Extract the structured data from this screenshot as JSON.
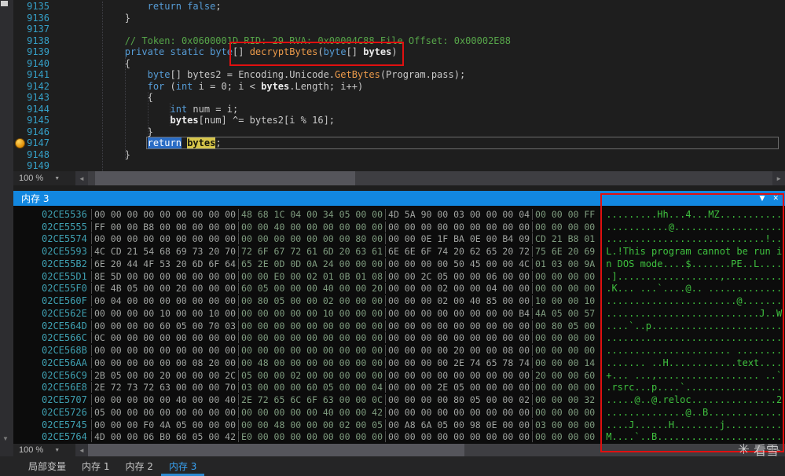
{
  "colors": {
    "accent_blue": "#1287e0",
    "annotation_red": "#e01010",
    "ascii_green": "#3fc13f",
    "address_teal": "#3e9fb0",
    "keyword_blue": "#569cd6",
    "comment_green": "#57a64a",
    "method_orange": "#ec9a4a",
    "selection_blue": "#2a6cc4",
    "highlight_yellow": "#d6c54a",
    "breakpoint_orange": "#e08900"
  },
  "icons": {
    "chevron_down": "▼",
    "close": "✕",
    "left_arrow": "◄",
    "right_arrow": "►"
  },
  "editor": {
    "zoom": "100 %",
    "current_line": "9147",
    "lines": [
      {
        "num": "9135",
        "tokens": [
          [
            "p",
            "                "
          ],
          [
            "k",
            "return"
          ],
          [
            "p",
            " "
          ],
          [
            "k",
            "false"
          ],
          [
            "p",
            ";"
          ]
        ]
      },
      {
        "num": "9136",
        "tokens": [
          [
            "p",
            "            }"
          ]
        ]
      },
      {
        "num": "9137",
        "tokens": []
      },
      {
        "num": "9138",
        "tokens": [
          [
            "p",
            "            "
          ],
          [
            "c",
            "// Token: 0x0600001D RID: 29 RVA: 0x00004C88 File Offset: 0x00002E88"
          ]
        ]
      },
      {
        "num": "9139",
        "tokens": [
          [
            "p",
            "            "
          ],
          [
            "k",
            "private"
          ],
          [
            "p",
            " "
          ],
          [
            "k",
            "static"
          ],
          [
            "p",
            " "
          ],
          [
            "k",
            "byte"
          ],
          [
            "p",
            "[] "
          ],
          [
            "m",
            "decryptBytes"
          ],
          [
            "p",
            "("
          ],
          [
            "k",
            "byte"
          ],
          [
            "p",
            "[] "
          ],
          [
            "b",
            "bytes"
          ],
          [
            "p",
            ")"
          ]
        ]
      },
      {
        "num": "9140",
        "tokens": [
          [
            "p",
            "            {"
          ]
        ]
      },
      {
        "num": "9141",
        "tokens": [
          [
            "p",
            "                "
          ],
          [
            "k",
            "byte"
          ],
          [
            "p",
            "[] bytes2 = Encoding.Unicode."
          ],
          [
            "m",
            "GetBytes"
          ],
          [
            "p",
            "(Program.pass);"
          ]
        ]
      },
      {
        "num": "9142",
        "tokens": [
          [
            "p",
            "                "
          ],
          [
            "k",
            "for"
          ],
          [
            "p",
            " ("
          ],
          [
            "k",
            "int"
          ],
          [
            "p",
            " i = 0; i < "
          ],
          [
            "b",
            "bytes"
          ],
          [
            "p",
            ".Length; i++)"
          ]
        ]
      },
      {
        "num": "9143",
        "tokens": [
          [
            "p",
            "                {"
          ]
        ]
      },
      {
        "num": "9144",
        "tokens": [
          [
            "p",
            "                    "
          ],
          [
            "k",
            "int"
          ],
          [
            "p",
            " num = i;"
          ]
        ]
      },
      {
        "num": "9145",
        "tokens": [
          [
            "p",
            "                    "
          ],
          [
            "b",
            "bytes"
          ],
          [
            "p",
            "[num] ^= bytes2[i % 16];"
          ]
        ]
      },
      {
        "num": "9146",
        "tokens": [
          [
            "p",
            "                }"
          ]
        ]
      },
      {
        "num": "9147",
        "current": true,
        "tokens": [
          [
            "p",
            "                "
          ],
          [
            "sel",
            "return"
          ],
          [
            "p",
            " "
          ],
          [
            "hl",
            "bytes"
          ],
          [
            "p",
            ";"
          ]
        ]
      },
      {
        "num": "9148",
        "tokens": [
          [
            "p",
            "            }"
          ]
        ]
      },
      {
        "num": "9149",
        "tokens": []
      }
    ]
  },
  "memory": {
    "title": "内存 3",
    "zoom": "100 %",
    "group_sizes": [
      9,
      9,
      9,
      4
    ],
    "rows": [
      {
        "addr": "02CE5536",
        "hex": "00 00 00 00 00 00 00 00 00 48 68 1C 04 00 34 05 00 00 4D 5A 90 00 03 00 00 00 04 00 00 00 FF",
        "ascii": ".........Hh...4...MZ..........."
      },
      {
        "addr": "02CE5555",
        "hex": "FF 00 00 B8 00 00 00 00 00 00 00 40 00 00 00 00 00 00 00 00 00 00 00 00 00 00 00 00 00 00 00",
        "ascii": "...........@..................."
      },
      {
        "addr": "02CE5574",
        "hex": "00 00 00 00 00 00 00 00 00 00 00 00 00 00 00 00 80 00 00 00 0E 1F BA 0E 00 B4 09 CD 21 B8 01",
        "ascii": "............................!.."
      },
      {
        "addr": "02CE5593",
        "hex": "4C CD 21 54 68 69 73 20 70 72 6F 67 72 61 6D 20 63 61 6E 6E 6F 74 20 62 65 20 72 75 6E 20 69",
        "ascii": "L.!This program cannot be run i"
      },
      {
        "addr": "02CE55B2",
        "hex": "6E 20 44 4F 53 20 6D 6F 64 65 2E 0D 0D 0A 24 00 00 00 00 00 00 00 50 45 00 00 4C 01 03 00 9A",
        "ascii": "n DOS mode....$.......PE..L...."
      },
      {
        "addr": "02CE55D1",
        "hex": "8E 5D 00 00 00 00 00 00 00 00 00 E0 00 02 01 0B 01 08 00 00 2C 05 00 00 06 00 00 00 00 00 00",
        "ascii": ".]..................,.........."
      },
      {
        "addr": "02CE55F0",
        "hex": "0E 4B 05 00 00 20 00 00 00 60 05 00 00 00 40 00 00 20 00 00 00 02 00 00 04 00 00 00 00 00 00",
        "ascii": ".K... ...`....@.. ............."
      },
      {
        "addr": "02CE560F",
        "hex": "00 04 00 00 00 00 00 00 00 00 80 05 00 00 02 00 00 00 00 00 00 02 00 40 85 00 00 10 00 00 10",
        "ascii": ".......................@......."
      },
      {
        "addr": "02CE562E",
        "hex": "00 00 00 00 10 00 00 10 00 00 00 00 00 00 10 00 00 00 00 00 00 00 00 00 00 00 B4 4A 05 00 57",
        "ascii": "...........................J..W"
      },
      {
        "addr": "02CE564D",
        "hex": "00 00 00 00 60 05 00 70 03 00 00 00 00 00 00 00 00 00 00 00 00 00 00 00 00 00 00 00 80 05 00",
        "ascii": "....`..p......................."
      },
      {
        "addr": "02CE566C",
        "hex": "0C 00 00 00 00 00 00 00 00 00 00 00 00 00 00 00 00 00 00 00 00 00 00 00 00 00 00 00 00 00 00",
        "ascii": "..............................."
      },
      {
        "addr": "02CE568B",
        "hex": "00 00 00 00 00 00 00 00 00 00 00 00 00 00 00 00 00 00 00 00 00 00 20 00 00 08 00 00 00 00 00",
        "ascii": "...................... ........"
      },
      {
        "addr": "02CE56AA",
        "hex": "00 00 00 00 00 00 08 20 00 00 48 00 00 00 00 00 00 00 00 00 00 00 2E 74 65 78 74 00 00 00 14",
        "ascii": "....... ..H............text...."
      },
      {
        "addr": "02CE56C9",
        "hex": "2B 05 00 00 20 00 00 00 2C 05 00 00 02 00 00 00 00 00 00 00 00 00 00 00 00 00 00 20 00 00 60",
        "ascii": "+... ...,.................. ..`"
      },
      {
        "addr": "02CE56E8",
        "hex": "2E 72 73 72 63 00 00 00 70 03 00 00 00 60 05 00 00 04 00 00 00 2E 05 00 00 00 00 00 00 00 00",
        "ascii": ".rsrc...p....`................."
      },
      {
        "addr": "02CE5707",
        "hex": "00 00 00 00 00 40 00 00 40 2E 72 65 6C 6F 63 00 00 0C 00 00 00 00 80 05 00 00 02 00 00 00 32",
        "ascii": ".....@..@.reloc...............2"
      },
      {
        "addr": "02CE5726",
        "hex": "05 00 00 00 00 00 00 00 00 00 00 00 00 00 40 00 00 42 00 00 00 00 00 00 00 00 00 00 00 00 00",
        "ascii": "..............@..B............."
      },
      {
        "addr": "02CE5745",
        "hex": "00 00 00 F0 4A 05 00 00 00 00 00 48 00 00 00 02 00 05 00 A8 6A 05 00 98 0E 00 00 03 00 00 00",
        "ascii": "....J......H........j.........."
      },
      {
        "addr": "02CE5764",
        "hex": "4D 00 00 06 B0 60 05 00 42 E0 00 00 00 00 00 00 00 00 00 00 00 00 00 00 00 00 00 00 00 00 00",
        "ascii": "M....`..B......................"
      }
    ]
  },
  "bottom_tabs": [
    {
      "id": "locals",
      "label": "局部变量",
      "active": false
    },
    {
      "id": "memory-1",
      "label": "内存 1",
      "active": false
    },
    {
      "id": "memory-2",
      "label": "内存 2",
      "active": false
    },
    {
      "id": "memory-3",
      "label": "内存 3",
      "active": true
    }
  ],
  "watermark": {
    "icon_glyph": "✳",
    "text": "看雪"
  }
}
